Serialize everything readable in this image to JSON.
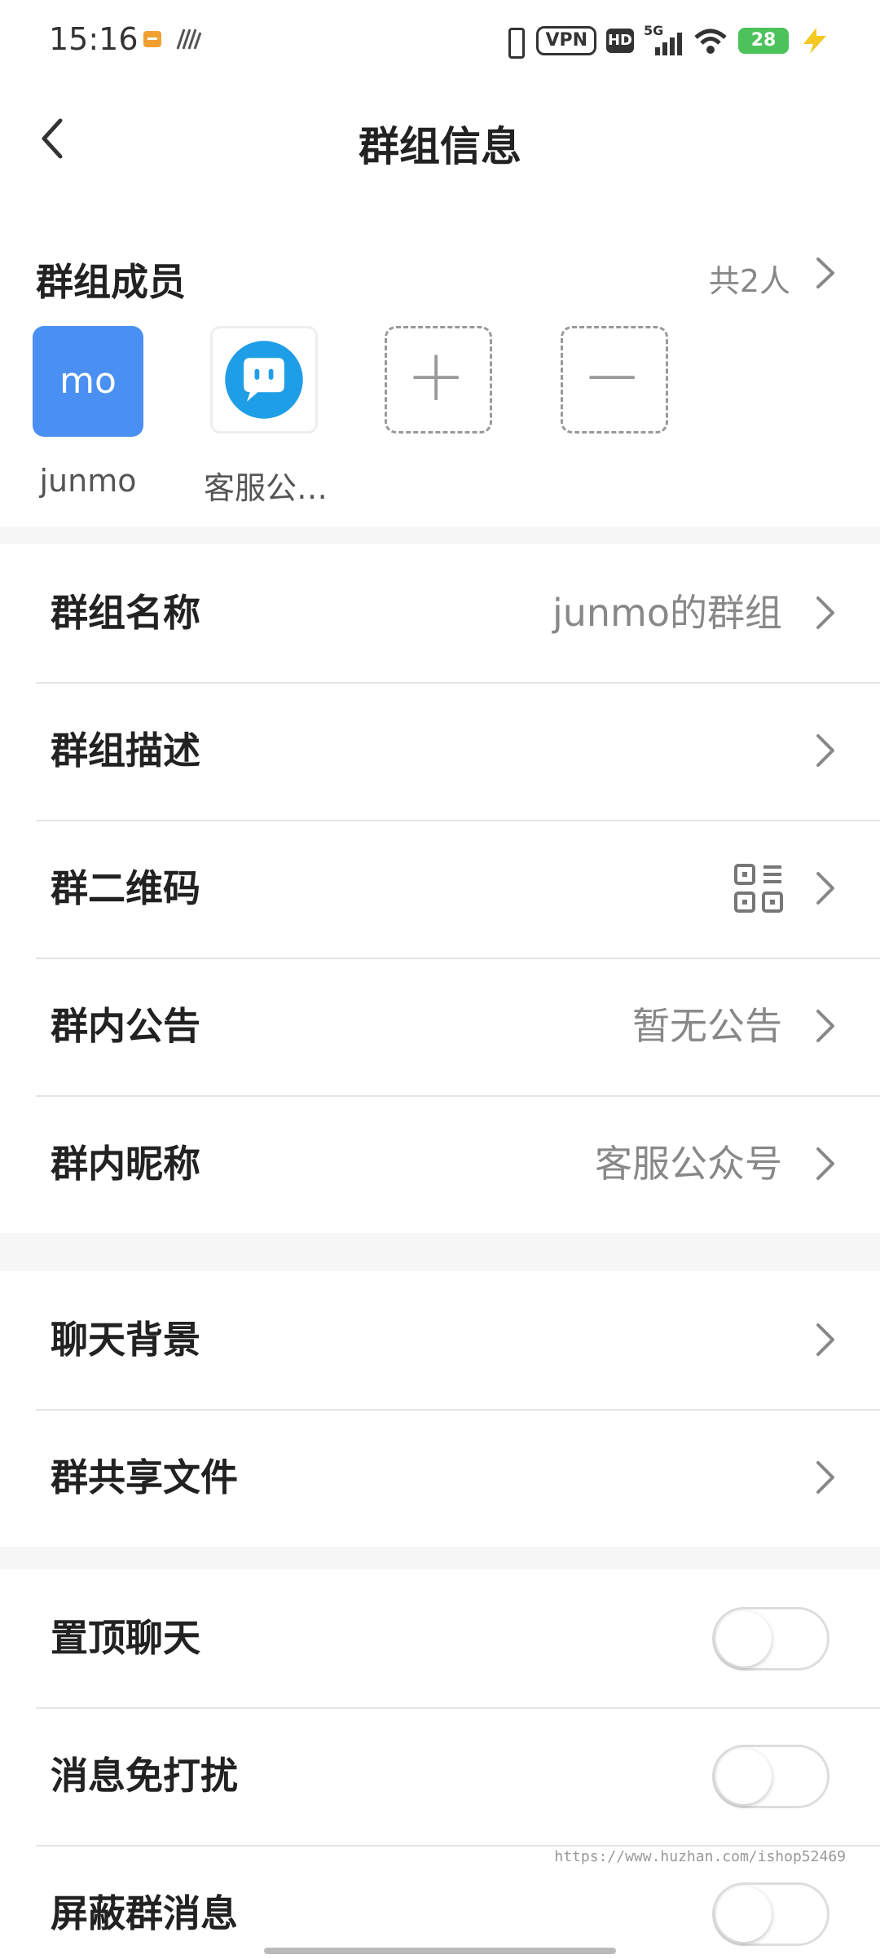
{
  "status_bar": {
    "time": "15:16",
    "vpn": "VPN",
    "hd": "HD",
    "network": "5G",
    "battery": "28",
    "battery_color": "#4cc35a"
  },
  "nav": {
    "title": "群组信息",
    "back_icon": "chevron-left-icon"
  },
  "members": {
    "title": "群组成员",
    "count": "共2人",
    "list": [
      {
        "avatar_text": "mo",
        "name": "junmo",
        "avatar_color": "#4a90f2"
      },
      {
        "avatar_icon": "chat-bubble-icon",
        "name": "客服公…",
        "avatar_color": "#1e9ee6"
      }
    ],
    "add_icon": "plus-icon",
    "remove_icon": "minus-icon"
  },
  "section1": [
    {
      "label": "群组名称",
      "value": "junmo的群组"
    },
    {
      "label": "群组描述",
      "value": ""
    },
    {
      "label": "群二维码",
      "value_icon": "qr-code-icon"
    },
    {
      "label": "群内公告",
      "value": "暂无公告"
    },
    {
      "label": "群内昵称",
      "value": "客服公众号"
    }
  ],
  "section2": [
    {
      "label": "聊天背景"
    },
    {
      "label": "群共享文件"
    }
  ],
  "section3": [
    {
      "label": "置顶聊天",
      "on": false
    },
    {
      "label": "消息免打扰",
      "on": false
    },
    {
      "label": "屏蔽群消息",
      "on": false
    }
  ],
  "watermark": "https://www.huzhan.com/ishop52469"
}
